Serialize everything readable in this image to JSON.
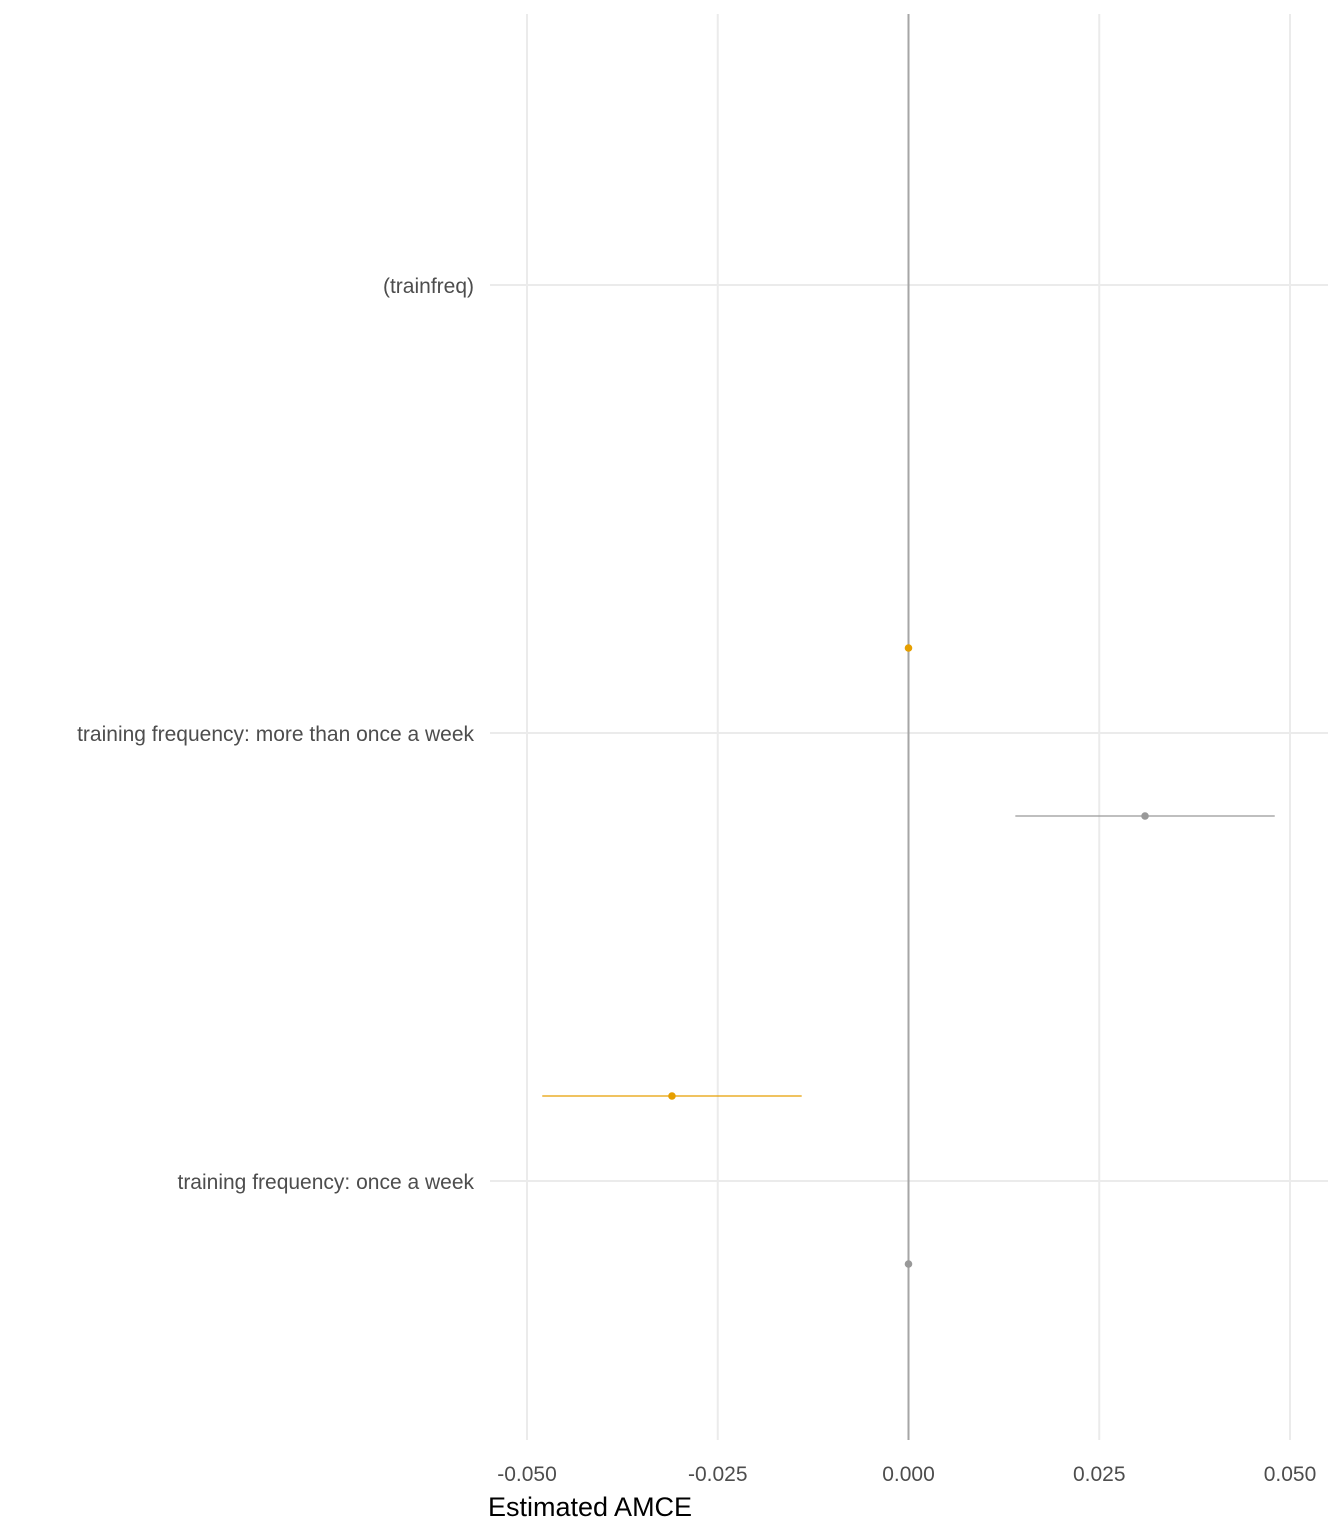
{
  "chart_data": {
    "type": "scatter",
    "subtype": "coefficient-plot",
    "title": "",
    "xlabel": "Estimated AMCE",
    "ylabel": "",
    "xlim": [
      -0.05,
      0.05
    ],
    "x_ticks": [
      -0.05,
      -0.025,
      0.0,
      0.025,
      0.05
    ],
    "x_tick_labels": [
      "-0.050",
      "-0.025",
      "0.000",
      "0.025",
      "0.050"
    ],
    "categories": [
      "(trainfreq)",
      "training frequency: more than once a week",
      "training frequency: once a week"
    ],
    "grid": true,
    "legend": "none",
    "reference_line": 0,
    "series": [
      {
        "color": "#E69F00",
        "points": [
          {
            "category": "training frequency: more than once a week",
            "estimate": 0.0,
            "lower": 0.0,
            "upper": 0.0
          },
          {
            "category": "training frequency: once a week",
            "estimate": -0.031,
            "lower": -0.048,
            "upper": -0.014
          }
        ]
      },
      {
        "color": "#999999",
        "points": [
          {
            "category": "training frequency: more than once a week",
            "estimate": 0.031,
            "lower": 0.014,
            "upper": 0.048
          },
          {
            "category": "training frequency: once a week",
            "estimate": 0.0,
            "lower": 0.0,
            "upper": 0.0
          }
        ]
      }
    ]
  }
}
